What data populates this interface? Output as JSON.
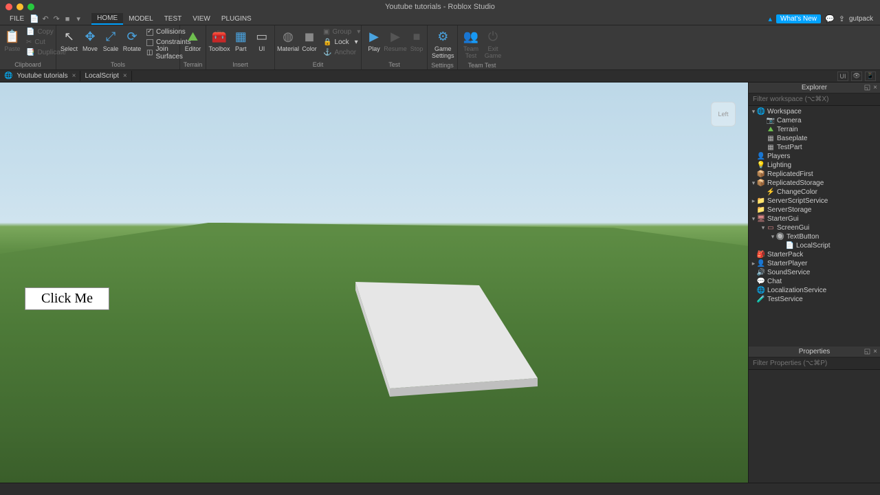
{
  "title": "Youtube tutorials - Roblox Studio",
  "menu": {
    "file": "FILE",
    "tabs": [
      "HOME",
      "MODEL",
      "TEST",
      "VIEW",
      "PLUGINS"
    ],
    "active": "HOME"
  },
  "topright": {
    "whatsnew": "What's New",
    "username": "gutpack"
  },
  "ribbon": {
    "clipboard": {
      "label": "Clipboard",
      "paste": "Paste",
      "copy": "Copy",
      "cut": "Cut",
      "dup": "Duplicate"
    },
    "tools": {
      "label": "Tools",
      "select": "Select",
      "move": "Move",
      "scale": "Scale",
      "rotate": "Rotate",
      "collisions": "Collisions",
      "constraints": "Constraints",
      "join": "Join Surfaces"
    },
    "terrain": {
      "label": "Terrain",
      "editor": "Editor"
    },
    "insert": {
      "label": "Insert",
      "toolbox": "Toolbox",
      "part": "Part",
      "ui": "UI"
    },
    "edit": {
      "label": "Edit",
      "material": "Material",
      "color": "Color",
      "group": "Group",
      "lock": "Lock",
      "anchor": "Anchor"
    },
    "test": {
      "label": "Test",
      "play": "Play",
      "resume": "Resume",
      "stop": "Stop"
    },
    "settings": {
      "label": "Settings",
      "game": "Game\nSettings"
    },
    "teamtest": {
      "label": "Team Test",
      "team": "Team\nTest",
      "exit": "Exit\nGame"
    }
  },
  "doctabs": {
    "t1": "Youtube tutorials",
    "t2": "LocalScript"
  },
  "viewport": {
    "button": "Click Me",
    "cube": "Left"
  },
  "explorer": {
    "title": "Explorer",
    "filter_placeholder": "Filter workspace (⌥⌘X)",
    "tree": {
      "workspace": "Workspace",
      "camera": "Camera",
      "terrain": "Terrain",
      "baseplate": "Baseplate",
      "testpart": "TestPart",
      "players": "Players",
      "lighting": "Lighting",
      "replicatedfirst": "ReplicatedFirst",
      "replicatedstorage": "ReplicatedStorage",
      "changecolor": "ChangeColor",
      "serverscriptservice": "ServerScriptService",
      "serverstorage": "ServerStorage",
      "startergui": "StarterGui",
      "screengui": "ScreenGui",
      "textbutton": "TextButton",
      "localscript": "LocalScript",
      "starterpack": "StarterPack",
      "starterplayer": "StarterPlayer",
      "soundservice": "SoundService",
      "chat": "Chat",
      "localization": "LocalizationService",
      "testservice": "TestService"
    }
  },
  "properties": {
    "title": "Properties",
    "filter_placeholder": "Filter Properties (⌥⌘P)"
  }
}
